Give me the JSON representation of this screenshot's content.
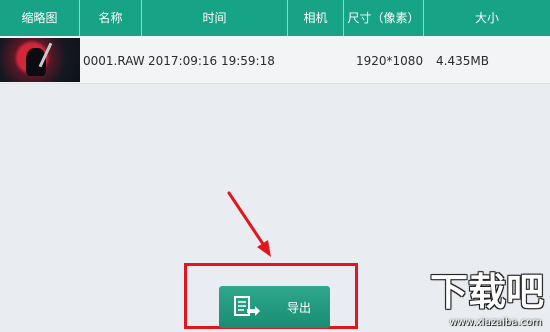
{
  "table": {
    "headers": [
      "缩略图",
      "名称",
      "时间",
      "相机",
      "尺寸（像素）",
      "大小"
    ],
    "rows": [
      {
        "name": "0001.RAW",
        "time": "2017:09:16 19:59:18",
        "camera": "",
        "dimensions": "1920*1080",
        "size": "4.435MB"
      }
    ]
  },
  "export_button": {
    "label": "导出",
    "icon": "export-icon"
  },
  "watermark": {
    "text": "下载吧",
    "url": "www.xiazaiba.com"
  },
  "colors": {
    "header": "#16a386",
    "highlight": "#e2161c",
    "button": "#1f9a7f"
  }
}
